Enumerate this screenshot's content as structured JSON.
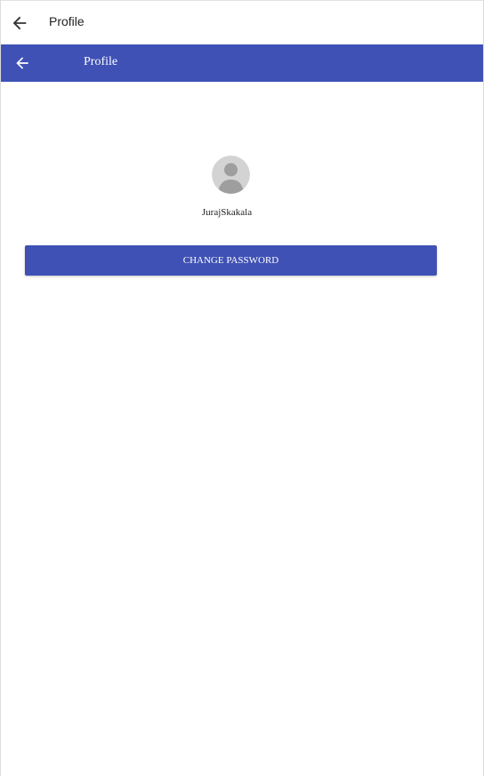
{
  "topbar": {
    "title": "Profile",
    "back_icon": "arrow-left-icon"
  },
  "appbar": {
    "title": "Profile",
    "back_icon": "arrow-left-icon",
    "color": "#3f51b5"
  },
  "profile": {
    "avatar_icon": "default-user-avatar-icon",
    "username": "JurajSkakala"
  },
  "actions": {
    "change_password_label": "CHANGE PASSWORD"
  },
  "colors": {
    "primary": "#3f51b5",
    "background": "#ffffff",
    "avatar_bg": "#d3d3d3",
    "avatar_fg": "#9e9e9e"
  }
}
